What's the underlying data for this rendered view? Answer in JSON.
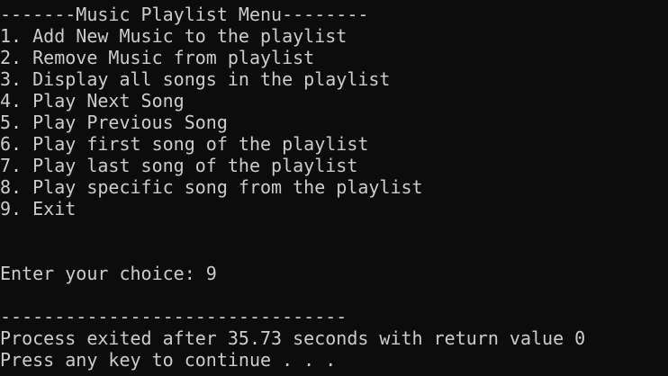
{
  "console": {
    "background": "#0c0c0c",
    "foreground": "#cccccc",
    "header": "-------Music Playlist Menu--------",
    "menu_items": [
      "1. Add New Music to the playlist",
      "2. Remove Music from playlist",
      "3. Display all songs in the playlist",
      "4. Play Next Song",
      "5. Play Previous Song",
      "6. Play first song of the playlist",
      "7. Play last song of the playlist",
      "8. Play specific song from the playlist",
      "9. Exit"
    ],
    "prompt": "Enter your choice: 9",
    "separator": "--------------------------------",
    "exit_message": "Process exited after 35.73 seconds with return value 0",
    "continue_message": "Press any key to continue . . ."
  }
}
